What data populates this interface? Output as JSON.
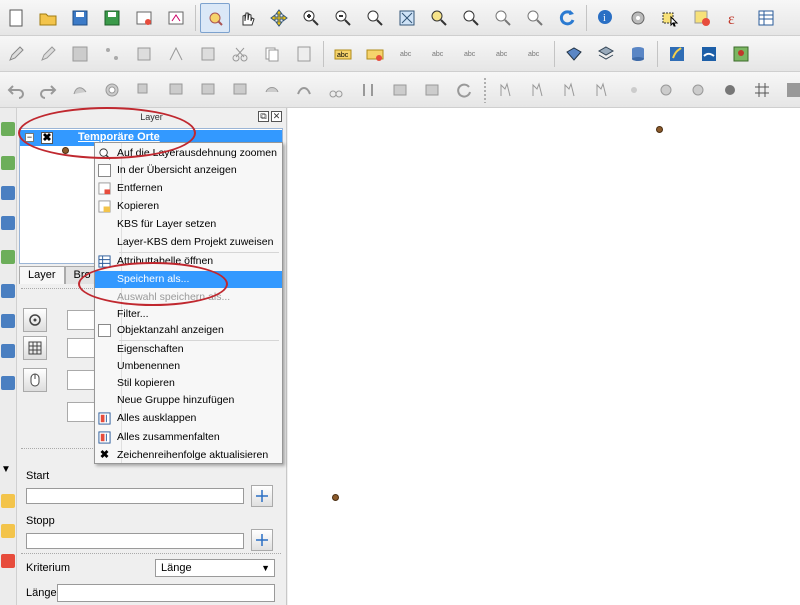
{
  "layer_panel": {
    "title": "Layer",
    "layer_name": "Temporäre Orte",
    "tabs": [
      "Layer",
      "Bro"
    ]
  },
  "context_menu": {
    "items": [
      {
        "label": "Auf die Layerausdehnung zoomen",
        "icon": "zoom-layer-icon"
      },
      {
        "label": "In der Übersicht anzeigen",
        "icon": "checkbox-icon"
      },
      {
        "label": "Entfernen",
        "icon": "remove-layer-icon"
      },
      {
        "label": "Kopieren",
        "icon": "copy-layer-icon"
      },
      {
        "label": "KBS für Layer setzen",
        "icon": ""
      },
      {
        "label": "Layer-KBS dem Projekt zuweisen",
        "icon": ""
      },
      {
        "label": "Attributtabelle öffnen",
        "icon": "attribute-table-icon"
      },
      {
        "label": "Speichern als...",
        "icon": ""
      },
      {
        "label": "Auswahl speichern als...",
        "icon": ""
      },
      {
        "label": "Filter...",
        "icon": ""
      },
      {
        "label": "Objektanzahl anzeigen",
        "icon": "checkbox-icon"
      },
      {
        "label": "Eigenschaften",
        "icon": ""
      },
      {
        "label": "Umbenennen",
        "icon": ""
      },
      {
        "label": "Stil kopieren",
        "icon": ""
      },
      {
        "label": "Neue Gruppe hinzufügen",
        "icon": ""
      },
      {
        "label": "Alles ausklappen",
        "icon": "expand-all-icon"
      },
      {
        "label": "Alles zusammenfalten",
        "icon": "collapse-all-icon"
      },
      {
        "label": "Zeichenreihenfolge aktualisieren",
        "icon": "check-x-icon"
      }
    ],
    "highlighted": "Speichern als...",
    "disabled": "Auswahl speichern als..."
  },
  "routing_form": {
    "start_label": "Start",
    "stop_label": "Stopp",
    "criterion_label": "Kriterium",
    "criterion_value": "Länge",
    "length_label": "Länge"
  },
  "colors": {
    "selection": "#3399ff",
    "annotation": "#c0282f",
    "point": "#8b5a2b"
  }
}
